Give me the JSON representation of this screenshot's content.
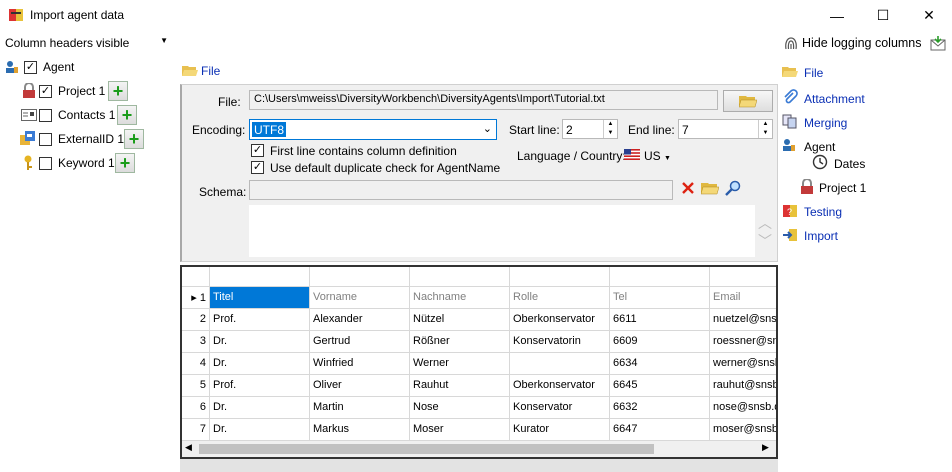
{
  "window": {
    "title": "Import agent data",
    "minimize": "—",
    "maximize": "☐",
    "close": "✕"
  },
  "left": {
    "column_headers_label": "Column headers",
    "column_headers_value": "visible",
    "tree": [
      {
        "label": "Agent",
        "checked": true
      },
      {
        "label": "Project 1",
        "checked": true
      },
      {
        "label": "Contacts 1",
        "checked": false
      },
      {
        "label": "ExternalID 1",
        "checked": false
      },
      {
        "label": "Keyword 1",
        "checked": false
      }
    ]
  },
  "file_tab": {
    "label": "File"
  },
  "form": {
    "file_label": "File:",
    "file_value": "C:\\Users\\mweiss\\DiversityWorkbench\\DiversityAgents\\Import\\Tutorial.txt",
    "encoding_label": "Encoding:",
    "encoding_value": "UTF8",
    "start_line_label": "Start line:",
    "start_line_value": "2",
    "end_line_label": "End line:",
    "end_line_value": "7",
    "first_line_label": "First line contains column definition",
    "dup_check_label": "Use default duplicate check for AgentName",
    "language_label": "Language / Country:",
    "language_value": "US",
    "schema_label": "Schema:"
  },
  "grid": {
    "columns": [
      "Titel",
      "Vorname",
      "Nachname",
      "Rolle",
      "Tel",
      "Email"
    ],
    "rows": [
      [
        "1",
        "Titel",
        "Vorname",
        "Nachname",
        "Rolle",
        "Tel",
        "Email"
      ],
      [
        "2",
        "Prof.",
        "Alexander",
        "Nützel",
        "Oberkonservator",
        "6611",
        "nuetzel@snsb."
      ],
      [
        "3",
        "Dr.",
        "Gertrud",
        "Rößner",
        "Konservatorin",
        "6609",
        "roessner@snsb"
      ],
      [
        "4",
        "Dr.",
        "Winfried",
        "Werner",
        "",
        "6634",
        "werner@snsb."
      ],
      [
        "5",
        "Prof.",
        "Oliver",
        "Rauhut",
        "Oberkonservator",
        "6645",
        "rauhut@snsb."
      ],
      [
        "6",
        "Dr.",
        "Martin",
        "Nose",
        "Konservator",
        "6632",
        "nose@snsb.d"
      ],
      [
        "7",
        "Dr.",
        "Markus",
        "Moser",
        "Kurator",
        "6647",
        "moser@snsb."
      ]
    ]
  },
  "right": {
    "hide_logging": "Hide logging columns",
    "nav": [
      {
        "label": "File",
        "link": true
      },
      {
        "label": "Attachment",
        "link": true
      },
      {
        "label": "Merging",
        "link": true
      },
      {
        "label": "Agent",
        "link": false
      },
      {
        "label": "Dates",
        "link": false
      },
      {
        "label": "Project 1",
        "link": false
      },
      {
        "label": "Testing",
        "link": true
      },
      {
        "label": "Import",
        "link": true
      }
    ]
  },
  "colors": {
    "accent": "#0078d7",
    "link": "#0a2fb4",
    "selected_cell": "#0078d7",
    "panel_bg": "#f0f0f0"
  }
}
